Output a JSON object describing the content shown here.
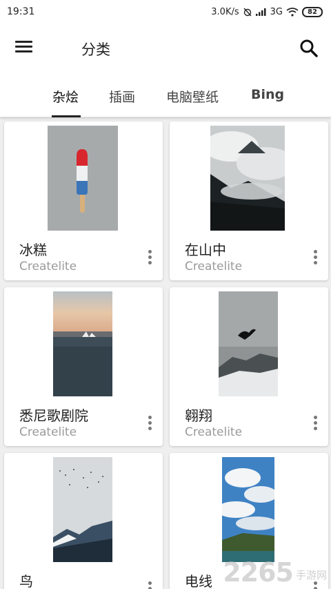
{
  "status_bar": {
    "time": "19:31",
    "net_speed": "3.0K/s",
    "network": "3G",
    "battery": "82"
  },
  "app_bar": {
    "title": "分类"
  },
  "tabs": [
    {
      "label": "杂烩",
      "active": true
    },
    {
      "label": "插画",
      "active": false
    },
    {
      "label": "电脑壁纸",
      "active": false
    },
    {
      "label": "Bing",
      "active": false
    }
  ],
  "cards": [
    {
      "title": "冰糕",
      "author": "Createlite"
    },
    {
      "title": "在山中",
      "author": "Createlite"
    },
    {
      "title": "悉尼歌剧院",
      "author": "Createlite"
    },
    {
      "title": "翱翔",
      "author": "Createlite"
    },
    {
      "title": "鸟",
      "author": ""
    },
    {
      "title": "电线",
      "author": ""
    }
  ],
  "watermark": {
    "big": "2265",
    "small": "手游网"
  },
  "colors": {
    "appbar": "#ffffff",
    "background": "#efefef",
    "author_text": "#9a9a9a"
  }
}
